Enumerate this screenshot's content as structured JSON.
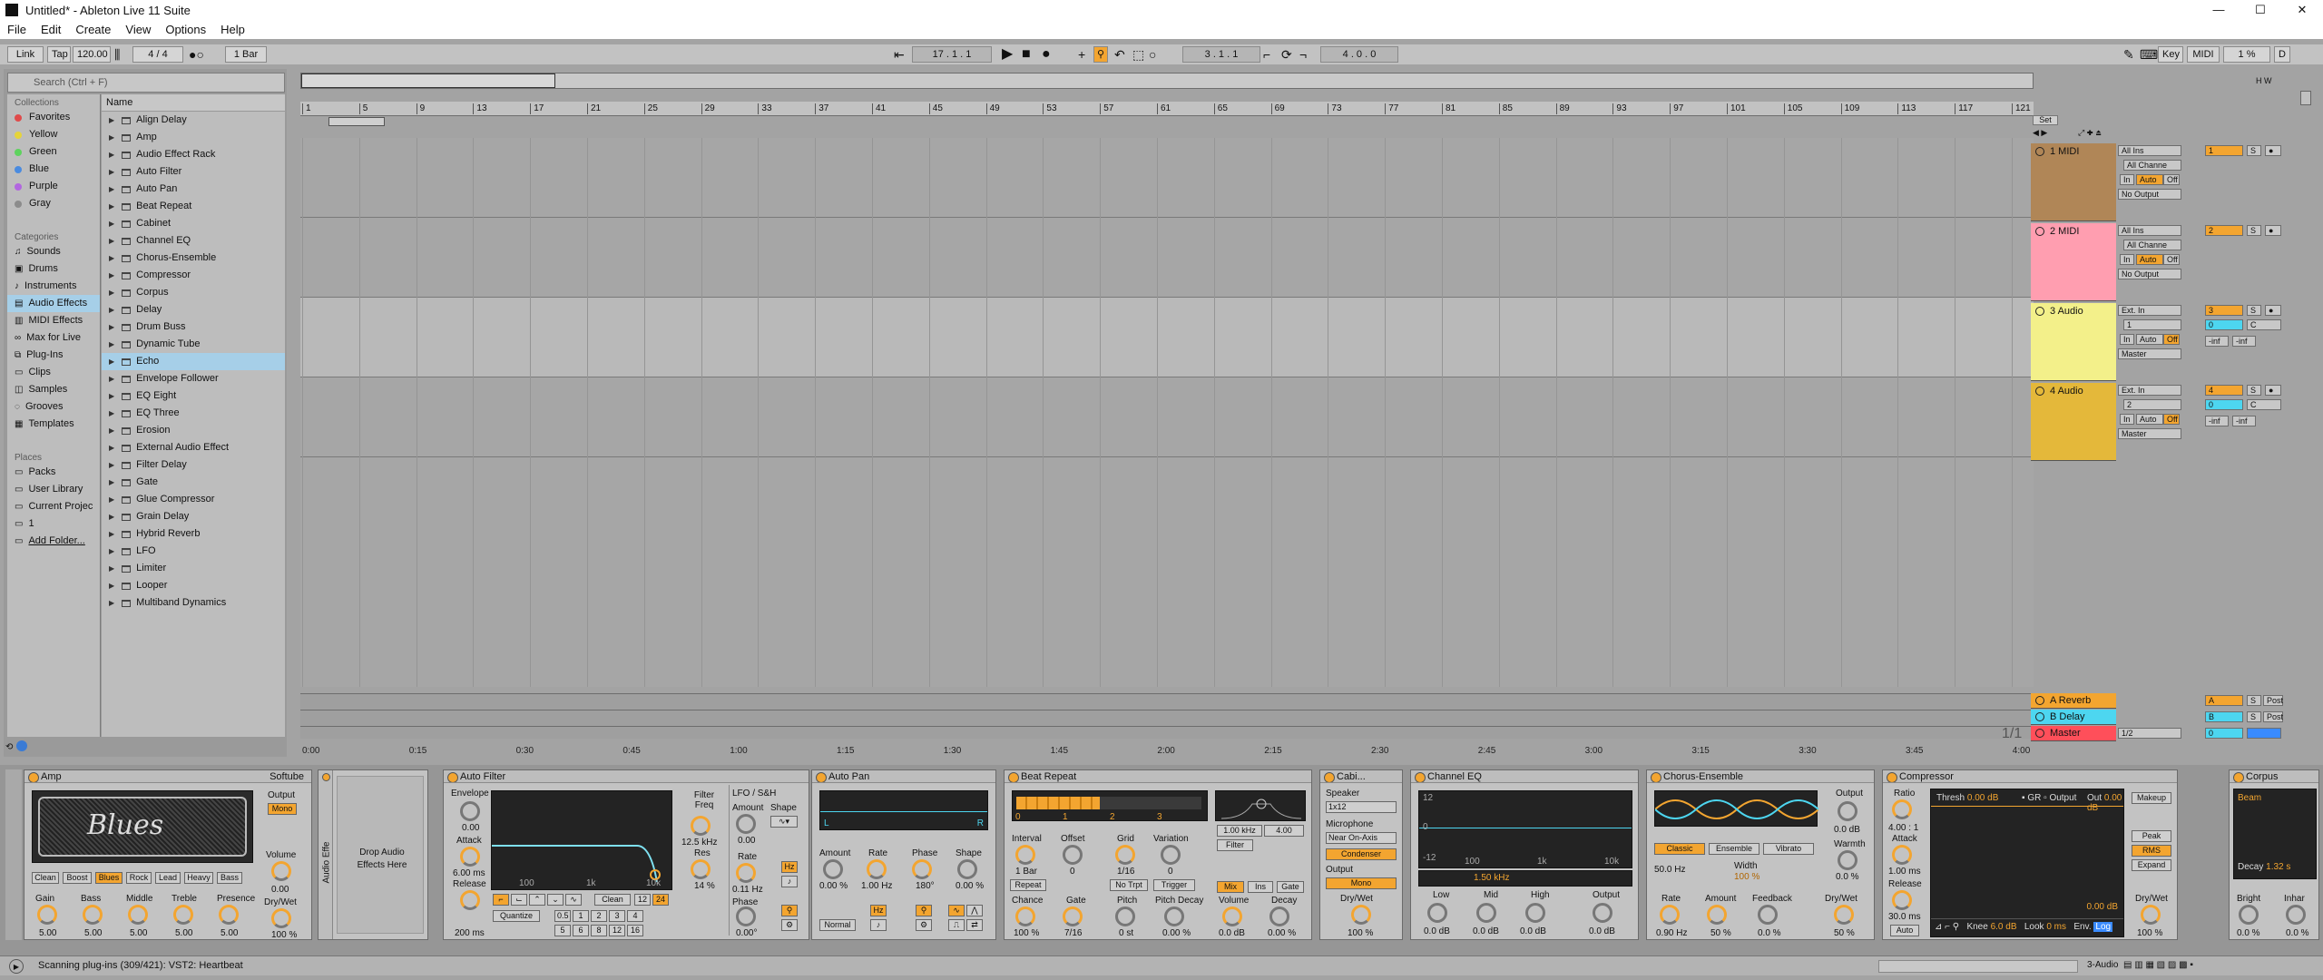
{
  "window": {
    "title": "Untitled* - Ableton Live 11 Suite",
    "min": "—",
    "max": "☐",
    "close": "✕",
    "icon": "live"
  },
  "menu": [
    "File",
    "Edit",
    "Create",
    "View",
    "Options",
    "Help"
  ],
  "control": {
    "link": "Link",
    "tap": "Tap",
    "tempo": "120.00",
    "sig": "4 / 4",
    "quant": "1 Bar",
    "pos1": "17 .  1 .  1",
    "pos2": "3 .  1 .  1",
    "pos3": "4 .  0 .  0",
    "key": "Key",
    "midi": "MIDI",
    "cpu": "1 %",
    "d": "D"
  },
  "browser": {
    "search_placeholder": "Search (Ctrl + F)",
    "collections_head": "Collections",
    "collections": [
      {
        "label": "Favorites",
        "color": "#e04a4a"
      },
      {
        "label": "Yellow",
        "color": "#e6d43a"
      },
      {
        "label": "Green",
        "color": "#5ed35e"
      },
      {
        "label": "Blue",
        "color": "#4a8be0"
      },
      {
        "label": "Purple",
        "color": "#b266e0"
      },
      {
        "label": "Gray",
        "color": "#8c8c8c"
      }
    ],
    "categories_head": "Categories",
    "categories": [
      "Sounds",
      "Drums",
      "Instruments",
      "Audio Effects",
      "MIDI Effects",
      "Max for Live",
      "Plug-Ins",
      "Clips",
      "Samples",
      "Grooves",
      "Templates"
    ],
    "places_head": "Places",
    "places": [
      "Packs",
      "User Library",
      "Current Projec",
      "1",
      "Add Folder..."
    ],
    "name_head": "Name",
    "items": [
      "Align Delay",
      "Amp",
      "Audio Effect Rack",
      "Auto Filter",
      "Auto Pan",
      "Beat Repeat",
      "Cabinet",
      "Channel EQ",
      "Chorus-Ensemble",
      "Compressor",
      "Corpus",
      "Delay",
      "Drum Buss",
      "Dynamic Tube",
      "Echo",
      "Envelope Follower",
      "EQ Eight",
      "EQ Three",
      "Erosion",
      "External Audio Effect",
      "Filter Delay",
      "Gate",
      "Glue Compressor",
      "Grain Delay",
      "Hybrid Reverb",
      "LFO",
      "Limiter",
      "Looper",
      "Multiband Dynamics"
    ]
  },
  "ruler": [
    "1",
    "5",
    "9",
    "13",
    "17",
    "21",
    "25",
    "29",
    "33",
    "37",
    "41",
    "45",
    "49",
    "53",
    "57",
    "61",
    "65",
    "69",
    "73",
    "77",
    "81",
    "85",
    "89",
    "93",
    "97",
    "101",
    "105",
    "109",
    "113",
    "117",
    "121"
  ],
  "timeline": [
    "0:00",
    "0:15",
    "0:30",
    "0:45",
    "1:00",
    "1:15",
    "1:30",
    "1:45",
    "2:00",
    "2:15",
    "2:30",
    "2:45",
    "3:00",
    "3:15",
    "3:30",
    "3:45",
    "4:00"
  ],
  "set_label": "Set",
  "pager": "1/1",
  "tracks": [
    {
      "name": "1 MIDI",
      "color": "#b08657",
      "in": "All Ins",
      "ch": "All Channe",
      "out": "No Output",
      "num": "1",
      "in_label": "In",
      "auto": "Auto",
      "off": "Off",
      "s": "S",
      "vol": "",
      "pan": ""
    },
    {
      "name": "2 MIDI",
      "color": "#ff9eb0",
      "in": "All Ins",
      "ch": "All Channe",
      "out": "No Output",
      "num": "2",
      "in_label": "In",
      "auto": "Auto",
      "off": "Off",
      "s": "S",
      "vol": "",
      "pan": ""
    },
    {
      "name": "3 Audio",
      "color": "#f3f08a",
      "in": "Ext. In",
      "ch": "1",
      "out": "Master",
      "num": "3",
      "in_label": "In",
      "auto": "Auto",
      "off": "Off",
      "s": "S",
      "vol": "0",
      "pan": "C"
    },
    {
      "name": "4 Audio",
      "color": "#e4b83a",
      "in": "Ext. In",
      "ch": "2",
      "out": "Master",
      "num": "4",
      "in_label": "In",
      "auto": "Auto",
      "off": "Off",
      "s": "S",
      "vol": "0",
      "pan": "C"
    }
  ],
  "inf": "-inf",
  "returns": [
    {
      "name": "A Reverb",
      "color": "#f3a530",
      "letter": "A",
      "s": "S",
      "post": "Post"
    },
    {
      "name": "B Delay",
      "color": "#4dd6f0",
      "letter": "B",
      "s": "S",
      "post": "Post"
    },
    {
      "name": "Master",
      "color": "#ff4f5a",
      "letter": "0",
      "s": "",
      "post": "",
      "cue": "1/2"
    }
  ],
  "devices": {
    "amp": {
      "title": "Amp",
      "softube": "Softube",
      "logo": "Blues",
      "output": "Output",
      "mono": "Mono",
      "volume": "Volume",
      "volume_val": "0.00",
      "drywet": "Dry/Wet",
      "drywet_val": "100 %",
      "types": [
        "Clean",
        "Boost",
        "Blues",
        "Rock",
        "Lead",
        "Heavy",
        "Bass"
      ],
      "knobs": [
        {
          "l": "Gain",
          "v": "5.00"
        },
        {
          "l": "Bass",
          "v": "5.00"
        },
        {
          "l": "Middle",
          "v": "5.00"
        },
        {
          "l": "Treble",
          "v": "5.00"
        },
        {
          "l": "Presence",
          "v": "5.00"
        }
      ]
    },
    "rack": {
      "title": "Audio Effe",
      "drop": "Drop Audio Effects Here"
    },
    "autofilter": {
      "title": "Auto Filter",
      "envelope": "Envelope",
      "env_val": "0.00",
      "attack": "Attack",
      "attack_val": "6.00 ms",
      "release": "Release",
      "release_val": "200 ms",
      "freq": "Filter Freq",
      "freq_val": "12.5 kHz",
      "res": "Res",
      "res_val": "14 %",
      "lfo": "LFO / S&H",
      "amount": "Amount",
      "amount_val": "0.00",
      "shape": "Shape",
      "rate": "Rate",
      "rate_val": "0.11 Hz",
      "phase": "Phase",
      "phase_val": "0.00°",
      "quantize": "Quantize",
      "clean": "Clean",
      "hz": "Hz",
      "f1": "12",
      "f2": "24",
      "x1": "100",
      "x2": "1k",
      "x3": "10k",
      "qn": [
        "0.5",
        "1",
        "2",
        "3",
        "4",
        "5",
        "6",
        "8",
        "12",
        "16"
      ]
    },
    "autopan": {
      "title": "Auto Pan",
      "amount": "Amount",
      "amount_val": "0.00 %",
      "rate": "Rate",
      "rate_val": "1.00 Hz",
      "phase": "Phase",
      "phase_val": "180°",
      "shape": "Shape",
      "shape_val": "0.00 %",
      "normal": "Normal",
      "hz": "Hz",
      "l": "L",
      "r": "R"
    },
    "beatrepeat": {
      "title": "Beat Repeat",
      "interval": "Interval",
      "interval_val": "1 Bar",
      "offset": "Offset",
      "offset_val": "0",
      "grid": "Grid",
      "grid_val": "1/16",
      "variation": "Variation",
      "variation_val": "0",
      "repeat": "Repeat",
      "notrpt": "No Trpt",
      "trigger": "Trigger",
      "chance": "Chance",
      "chance_val": "100 %",
      "gate": "Gate",
      "gate_val": "7/16",
      "pitch": "Pitch",
      "pitch_val": "0 st",
      "pdecay": "Pitch Decay",
      "pdecay_val": "0.00 %",
      "mix": "Mix",
      "ins": "Ins",
      "gate2": "Gate",
      "volume": "Volume",
      "volume_val": "0.0 dB",
      "decay": "Decay",
      "decay_val": "0.00 %",
      "filter": "Filter",
      "fhz": "1.00 kHz",
      "fw": "4.00",
      "ticks": [
        "0",
        "1",
        "2",
        "3"
      ]
    },
    "cabinet": {
      "title": "Cabi...",
      "speaker": "Speaker",
      "speaker_val": "1x12",
      "mic": "Microphone",
      "mic_val": "Near On-Axis",
      "condenser": "Condenser",
      "output": "Output",
      "mono": "Mono",
      "drywet": "Dry/Wet",
      "drywet_val": "100 %"
    },
    "channeleq": {
      "title": "Channel EQ",
      "low": "Low",
      "low_val": "0.0 dB",
      "mid": "Mid",
      "mid_val": "0.0 dB",
      "high": "High",
      "high_val": "0.0 dB",
      "output": "Output",
      "output_val": "0.0 dB",
      "freq": "1.50 kHz",
      "y1": "12",
      "y2": "0",
      "y3": "-12",
      "x1": "100",
      "x2": "1k",
      "x3": "10k"
    },
    "chorus": {
      "title": "Chorus-Ensemble",
      "classic": "Classic",
      "ensemble": "Ensemble",
      "vibrato": "Vibrato",
      "hz": "50.0 Hz",
      "width": "Width",
      "width_val": "100 %",
      "output": "Output",
      "output_val": "0.0 dB",
      "warmth": "Warmth",
      "warmth_val": "0.0 %",
      "rate": "Rate",
      "rate_val": "0.90 Hz",
      "amount": "Amount",
      "amount_val": "50 %",
      "feedback": "Feedback",
      "feedback_val": "0.0 %",
      "drywet": "Dry/Wet",
      "drywet_val": "50 %"
    },
    "compressor": {
      "title": "Compressor",
      "ratio": "Ratio",
      "ratio_val": "4.00 : 1",
      "attack": "Attack",
      "attack_val": "1.00 ms",
      "release": "Release",
      "release_val": "30.0 ms",
      "auto": "Auto",
      "thresh": "Thresh",
      "thresh_val": "0.00 dB",
      "gr": "GR",
      "outlbl": "Output",
      "out": "Out",
      "out_val": "0.00 dB",
      "gr_val": "0.00 dB",
      "knee": "Knee",
      "knee_val": "6.0 dB",
      "look": "Look",
      "look_val": "0 ms",
      "env": "Env.",
      "env_val": "Log",
      "makeup": "Makeup",
      "peak": "Peak",
      "rms": "RMS",
      "expand": "Expand",
      "drywet": "Dry/Wet",
      "drywet_val": "100 %"
    },
    "corpus": {
      "title": "Corpus",
      "beam": "Beam",
      "decay": "Decay",
      "decay_val": "1.32 s",
      "bright": "Bright",
      "bright_val": "0.0 %",
      "inhar": "Inhar",
      "inhar_val": "0.0 %"
    }
  },
  "status": {
    "text": "Scanning plug-ins (309/421): VST2: Heartbeat",
    "track": "3-Audio"
  }
}
